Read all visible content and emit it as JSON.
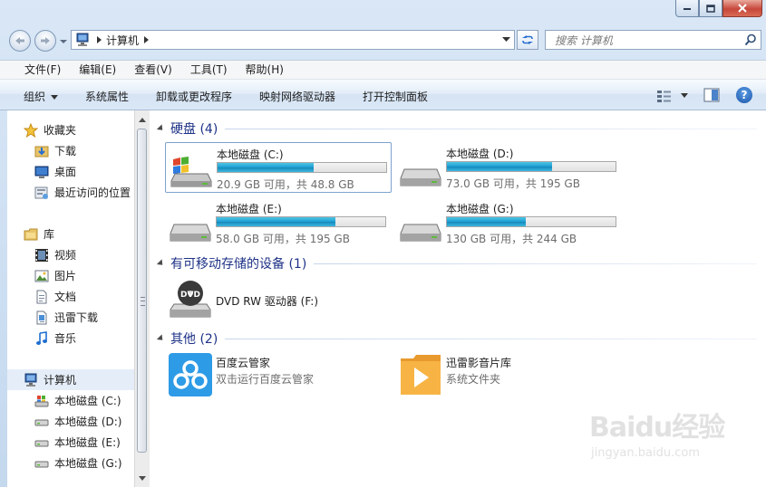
{
  "address": {
    "crumb": "计算机"
  },
  "search": {
    "placeholder": "搜索 计算机"
  },
  "menu": [
    "文件(F)",
    "编辑(E)",
    "查看(V)",
    "工具(T)",
    "帮助(H)"
  ],
  "commands": {
    "organize": "组织",
    "system_properties": "系统属性",
    "uninstall": "卸载或更改程序",
    "map_drive": "映射网络驱动器",
    "control_panel": "打开控制面板"
  },
  "nav": {
    "favorites": {
      "label": "收藏夹",
      "items": [
        "下载",
        "桌面",
        "最近访问的位置"
      ]
    },
    "libraries": {
      "label": "库",
      "items": [
        "视频",
        "图片",
        "文档",
        "迅雷下载",
        "音乐"
      ]
    },
    "computer": {
      "label": "计算机",
      "items": [
        "本地磁盘 (C:)",
        "本地磁盘 (D:)",
        "本地磁盘 (E:)",
        "本地磁盘 (G:)"
      ]
    }
  },
  "groups": {
    "hdd": "硬盘 (4)",
    "removable": "有可移动存储的设备 (1)",
    "other": "其他 (2)"
  },
  "drives": [
    {
      "name": "本地磁盘 (C:)",
      "free_text": "20.9 GB 可用，共 48.8 GB",
      "used_fraction": 0.572
    },
    {
      "name": "本地磁盘 (D:)",
      "free_text": "73.0 GB 可用，共 195 GB",
      "used_fraction": 0.626
    },
    {
      "name": "本地磁盘 (E:)",
      "free_text": "58.0 GB 可用，共 195 GB",
      "used_fraction": 0.703
    },
    {
      "name": "本地磁盘 (G:)",
      "free_text": "130 GB 可用，共 244 GB",
      "used_fraction": 0.467
    }
  ],
  "dvd": {
    "name": "DVD RW 驱动器 (F:)",
    "icon_label": "DVD"
  },
  "others": [
    {
      "name": "百度云管家",
      "desc": "双击运行百度云管家"
    },
    {
      "name": "迅雷影音片库",
      "desc": "系统文件夹"
    }
  ],
  "watermark": {
    "main": "Baidu经验",
    "url": "jingyan.baidu.com"
  },
  "colors": {
    "bar_fill": "#1e9ed2",
    "group_title": "#1e3287",
    "selection_border": "#7da2ce"
  }
}
